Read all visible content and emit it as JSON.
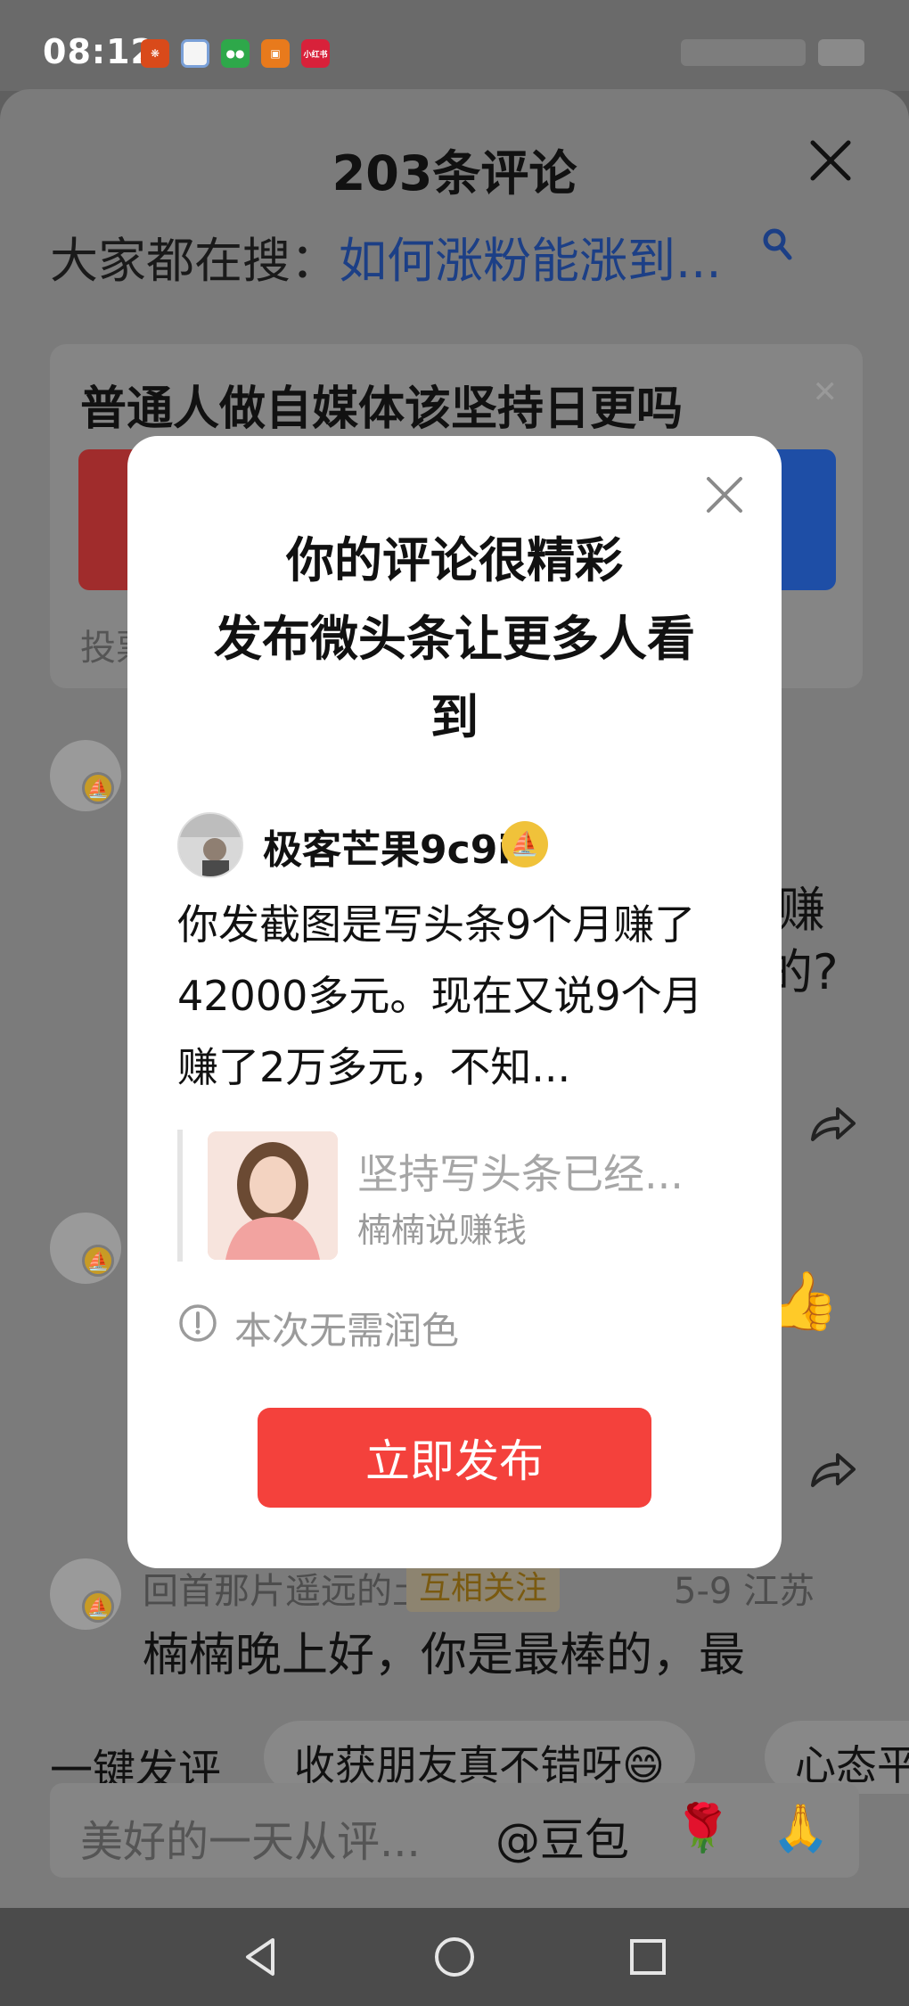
{
  "status_bar": {
    "time": "08:12",
    "app_icons": [
      "app-icon-1",
      "calendar-icon",
      "wechat-icon",
      "app-icon-4",
      "xiaohongshu-icon"
    ],
    "xiaohongshu_label": "小红书"
  },
  "sheet": {
    "title": "203条评论",
    "search_prefix": "大家都在搜：",
    "search_keyword": "如何涨粉能涨到...",
    "card": {
      "title": "普通人做自媒体该坚持日更吗",
      "sub": "投票"
    },
    "fragments": {
      "c1_tail": "赚",
      "c1_tail2": "的?"
    },
    "comment3": {
      "name": "回首那片遥远的土地",
      "tag": "互相关注",
      "meta": "5-9  江苏",
      "text": "楠楠晚上好，你是最棒的，最"
    },
    "quick": {
      "label": "一键发评",
      "chips": [
        "收获朋友真不错呀😄",
        "心态平"
      ]
    },
    "input": {
      "placeholder": "美好的一天从评...",
      "doubao": "@豆包",
      "emoji1": "🌹",
      "emoji2": "🙏"
    }
  },
  "modal": {
    "title_line1": "你的评论很精彩",
    "title_line2": "发布微头条让更多人看",
    "title_line3": "到",
    "username": "极客芒果9c9i",
    "comment_text": "你发截图是写头条9个月赚了42000多元。现在又说9个月赚了2万多元，不知...",
    "quote_title": "坚持写头条已经...",
    "quote_author": "楠楠说赚钱",
    "notice": "本次无需润色",
    "publish_label": "立即发布"
  },
  "colors": {
    "publish": "#f4413c",
    "keyword": "#1c3f86",
    "badge": "#f0c23a"
  }
}
